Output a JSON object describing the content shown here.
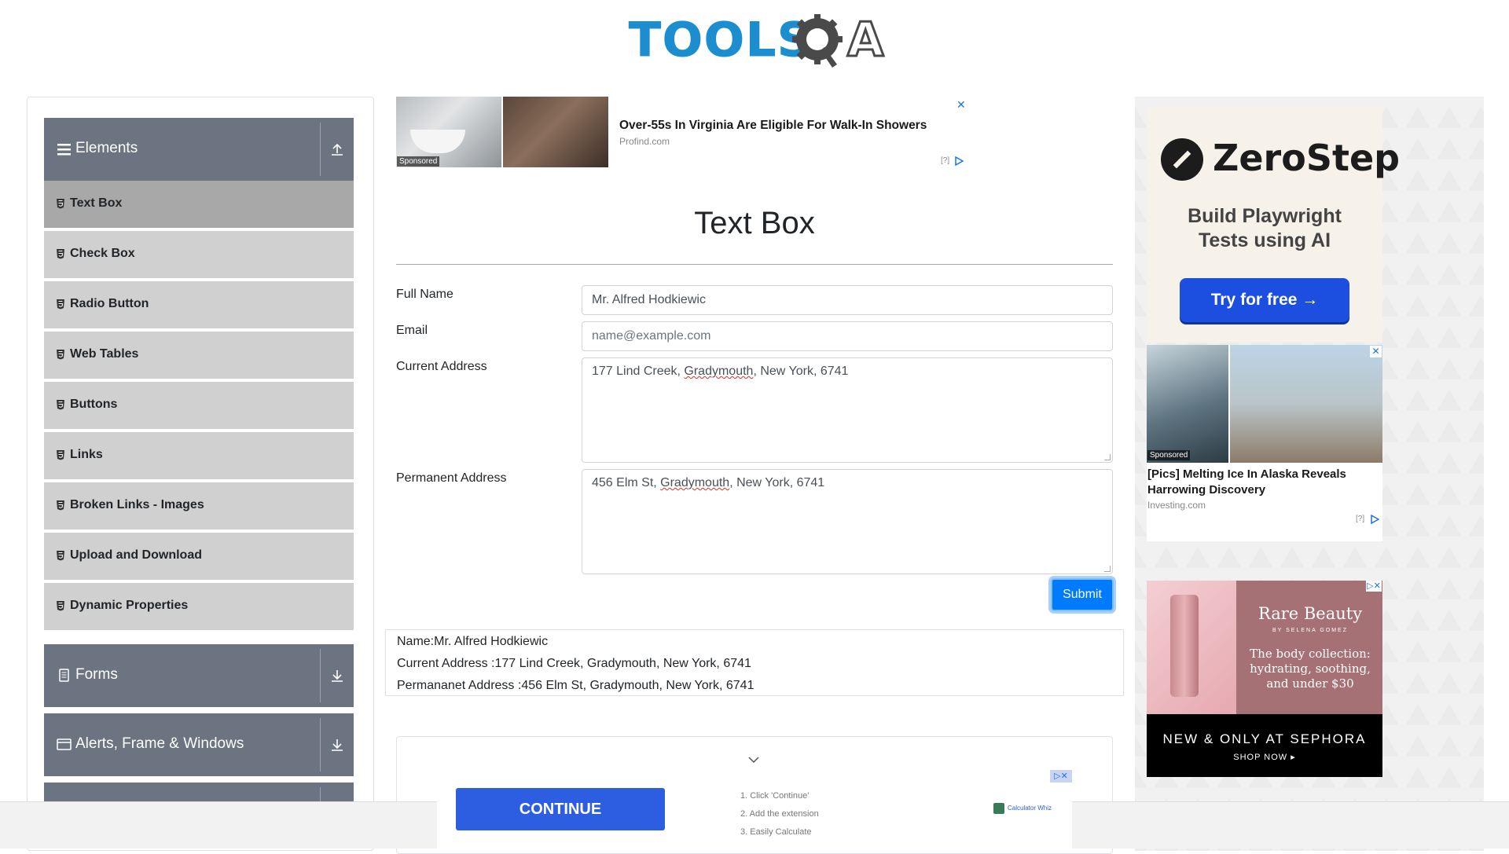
{
  "header": {
    "logo_primary": "TOOLS",
    "logo_secondary": "A"
  },
  "sidebar": {
    "groups": [
      {
        "label": "Elements",
        "icon": "hamburger-icon",
        "toggle": "collapse-arrow-icon"
      },
      {
        "label": "Forms",
        "icon": "document-icon",
        "toggle": "expand-arrow-icon"
      },
      {
        "label": "Alerts, Frame & Windows",
        "icon": "window-icon",
        "toggle": "expand-arrow-icon"
      }
    ],
    "items": [
      {
        "label": "Text Box",
        "active": true
      },
      {
        "label": "Check Box"
      },
      {
        "label": "Radio Button"
      },
      {
        "label": "Web Tables"
      },
      {
        "label": "Buttons"
      },
      {
        "label": "Links"
      },
      {
        "label": "Broken Links - Images"
      },
      {
        "label": "Upload and Download"
      },
      {
        "label": "Dynamic Properties"
      }
    ]
  },
  "ad_top": {
    "title": "Over-55s In Virginia Are Eligible For Walk-In Showers",
    "source": "Profind.com",
    "sponsored": "Sponsored",
    "close": "✕",
    "adchoice": "[?]"
  },
  "main": {
    "title": "Text Box",
    "form": {
      "full_name_label": "Full Name",
      "full_name_value": "Mr. Alfred Hodkiewic",
      "email_label": "Email",
      "email_placeholder": "name@example.com",
      "current_address_label": "Current Address",
      "current_address_value": {
        "pre": "177 Lind Creek, ",
        "spell": "Gradymouth",
        "post": ", New York, 6741"
      },
      "permanent_address_label": "Permanent Address",
      "permanent_address_value": {
        "pre": "456 Elm St, ",
        "spell": "Gradymouth",
        "post": ", New York, 6741"
      },
      "submit_label": "Submit"
    },
    "output": {
      "name": "Name:Mr. Alfred Hodkiewic",
      "current_address": "Current Address :177 Lind Creek, Gradymouth, New York, 6741",
      "permanent_address": "Permananet Address :456 Elm St, Gradymouth, New York, 6741"
    }
  },
  "right_ads": {
    "zerostep": {
      "brand": "ZeroStep",
      "headline_1": "Build Playwright",
      "headline_2": "Tests using AI",
      "cta": "Try for free →"
    },
    "melting_ice": {
      "title": "[Pics] Melting Ice In Alaska Reveals Harrowing Discovery",
      "source": "Investing.com",
      "sponsored": "Sponsored",
      "close": "✕",
      "adchoice": "[?]"
    },
    "rare_beauty": {
      "brand": "Rare Beauty",
      "sub": "BY SELENA GOMEZ",
      "copy": "The body collection: hydrating, soothing, and under $30",
      "band_title": "NEW & ONLY AT SEPHORA",
      "band_cta": "SHOP NOW ▸",
      "choice": "▷✕"
    }
  },
  "bottom_ad": {
    "cta": "CONTINUE",
    "step_1": "1. Click 'Continue'",
    "step_2": "2. Add the extension",
    "step_3": "3. Easily Calculate",
    "brand": "Calculator Whiz",
    "choice": "▷✕"
  },
  "colors": {
    "sidebar_header": "#6b7480",
    "sidebar_item": "#d0d0d0",
    "sidebar_item_active": "#a8a8a8",
    "submit": "#007bff",
    "logo_blue": "#1c8ecf"
  }
}
